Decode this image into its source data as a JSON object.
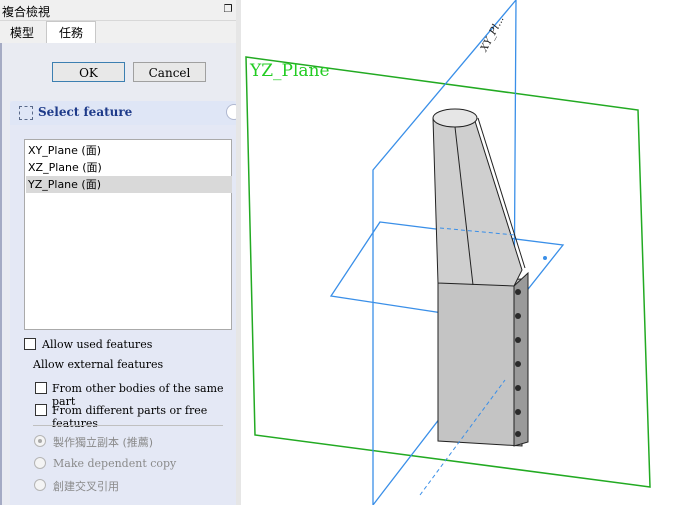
{
  "panel_title": "複合檢視",
  "restore_icon": "restore-icon",
  "tabs": [
    {
      "label": "模型"
    },
    {
      "label": "任務"
    }
  ],
  "buttons": {
    "ok": "OK",
    "cancel": "Cancel"
  },
  "select_feature": {
    "title": "Select feature",
    "items": [
      "XY_Plane (面)",
      "XZ_Plane (面)",
      "YZ_Plane (面)"
    ],
    "selected_index": 2
  },
  "options": {
    "allow_used": "Allow used features",
    "allow_external": "Allow external features",
    "from_other_bodies": "From  other bodies of the same part",
    "from_different_parts": "From different parts or free features"
  },
  "copy_modes": {
    "independent": "製作獨立副本 (推薦)",
    "dependent": "Make dependent copy",
    "cross_reference": "創建交叉引用"
  },
  "viewport": {
    "plane_label": "YZ_Plane",
    "rotated_label": "XY_Pl..."
  },
  "colors": {
    "yz_plane": "#22aa22",
    "blue_planes": "#3a8fe8",
    "title_text": "#1e3b8a"
  }
}
